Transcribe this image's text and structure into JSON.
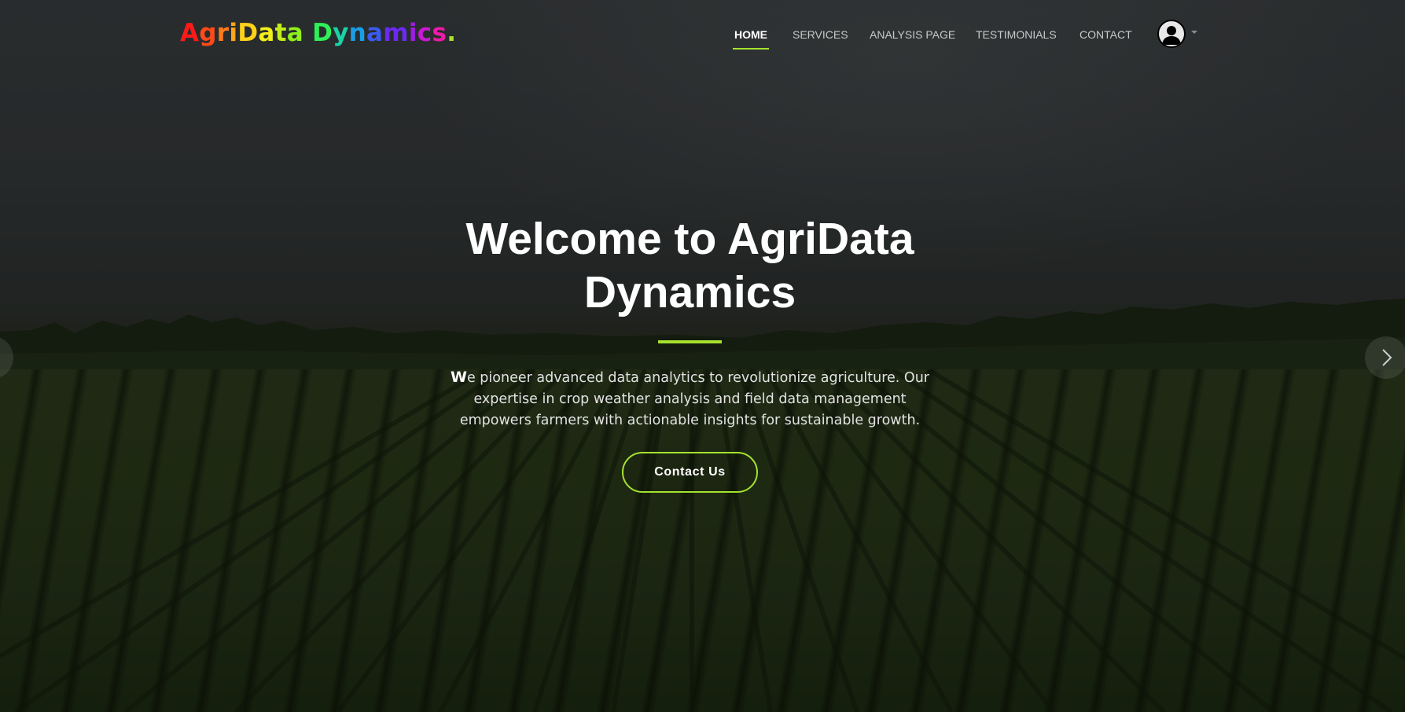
{
  "brand": {
    "logo_letters": [
      {
        "char": "A",
        "color": "#ff1a1a"
      },
      {
        "char": "g",
        "color": "#ff4a1a"
      },
      {
        "char": "r",
        "color": "#ff7a1a"
      },
      {
        "char": "i",
        "color": "#ffa51a"
      },
      {
        "char": "D",
        "color": "#ffd21a"
      },
      {
        "char": "a",
        "color": "#f2ee1a"
      },
      {
        "char": "t",
        "color": "#c2ee1a"
      },
      {
        "char": "a",
        "color": "#8ef01a"
      },
      {
        "char": " ",
        "color": "#ffffff"
      },
      {
        "char": "D",
        "color": "#2ef05a"
      },
      {
        "char": "y",
        "color": "#1ad2a8"
      },
      {
        "char": "n",
        "color": "#1a9ee8"
      },
      {
        "char": "a",
        "color": "#3a5af0"
      },
      {
        "char": "m",
        "color": "#6a2af0"
      },
      {
        "char": "i",
        "color": "#9a1ee0"
      },
      {
        "char": "c",
        "color": "#c81ad2"
      },
      {
        "char": "s",
        "color": "#ee1aa8"
      },
      {
        "char": ".",
        "color": "#a6e22e"
      }
    ]
  },
  "nav": {
    "items": [
      {
        "label": "HOME",
        "active": true
      },
      {
        "label": "SERVICES",
        "active": false
      },
      {
        "label": "ANALYSIS PAGE",
        "active": false
      },
      {
        "label": "TESTIMONIALS",
        "active": false
      },
      {
        "label": "CONTACT",
        "active": false
      }
    ],
    "user_menu_icon": "user-avatar-icon"
  },
  "hero": {
    "title_line1": "Welcome to AgriData",
    "title_line2": "Dynamics",
    "description_first": "W",
    "description_rest": "e pioneer advanced data analytics to revolutionize agriculture. Our expertise in crop weather analysis and field data management empowers farmers with actionable insights for sustainable growth.",
    "cta_label": "Contact Us"
  },
  "carousel": {
    "prev_icon": "chevron-left-icon",
    "next_icon": "chevron-right-icon"
  },
  "theme": {
    "accent": "#a6e22e",
    "text": "#ffffff"
  }
}
